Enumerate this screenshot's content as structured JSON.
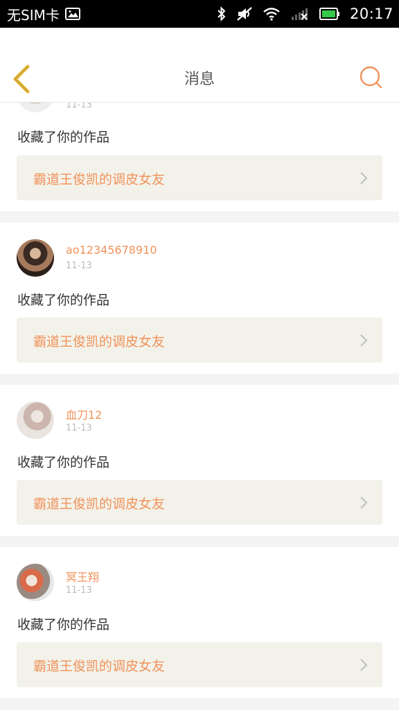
{
  "status_bar": {
    "carrier": "无SIM卡",
    "time": "20:17",
    "icons": [
      "image-icon",
      "bluetooth-icon",
      "mute-icon",
      "wifi-icon",
      "signal-icon",
      "battery-icon"
    ]
  },
  "header": {
    "title": "消息",
    "back_icon": "chevron-left-icon",
    "search_icon": "search-icon"
  },
  "colors": {
    "accent": "#f0925a",
    "back_icon": "#e6b735",
    "card_link_bg": "#f3f2ea"
  },
  "notifications": [
    {
      "username": "",
      "date": "11-13",
      "action": "收藏了你的作品",
      "work_title": "霸道王俊凯的调皮女友"
    },
    {
      "username": "ao12345678910",
      "date": "11-13",
      "action": "收藏了你的作品",
      "work_title": "霸道王俊凯的调皮女友"
    },
    {
      "username": "血刀12",
      "date": "11-13",
      "action": "收藏了你的作品",
      "work_title": "霸道王俊凯的调皮女友"
    },
    {
      "username": "冥王翔",
      "date": "11-13",
      "action": "收藏了你的作品",
      "work_title": "霸道王俊凯的调皮女友"
    }
  ]
}
